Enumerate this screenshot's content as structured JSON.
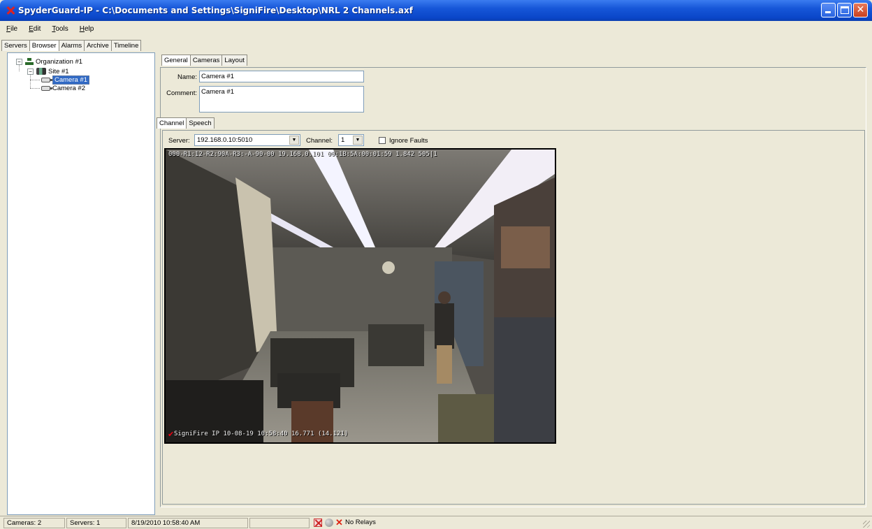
{
  "window": {
    "title": "SpyderGuard-IP - C:\\Documents and Settings\\SigniFire\\Desktop\\NRL 2 Channels.axf"
  },
  "menu": [
    {
      "label": "File",
      "underline": "F",
      "rest": "ile"
    },
    {
      "label": "Edit",
      "underline": "E",
      "rest": "dit"
    },
    {
      "label": "Tools",
      "underline": "T",
      "rest": "ools"
    },
    {
      "label": "Help",
      "underline": "H",
      "rest": "elp"
    }
  ],
  "left_tabs": [
    "Servers",
    "Browser",
    "Alarms",
    "Archive",
    "Timeline"
  ],
  "left_active_tab": "Browser",
  "tree": {
    "organization": "Organization #1",
    "site": "Site #1",
    "cameras": [
      "Camera #1",
      "Camera #2"
    ],
    "selected": "Camera #1"
  },
  "right_tabs": [
    "General",
    "Cameras",
    "Layout"
  ],
  "right_active_tab": "General",
  "general": {
    "name_label": "Name:",
    "name_value": "Camera #1",
    "comment_label": "Comment:",
    "comment_value": "Camera #1"
  },
  "channel_tabs": [
    "Channel",
    "Speech"
  ],
  "channel_active_tab": "Channel",
  "channel": {
    "server_label": "Server:",
    "server_value": "192.168.0.10:5010",
    "channel_label": "Channel:",
    "channel_value": "1",
    "ignore_faults_label": "Ignore Faults",
    "ignore_faults_checked": false
  },
  "camera_view": {
    "osd_top": "000-R1:12-R2:90A-R3:-A-90-00  19.168.0.101  00:1B:5A:00:01:59  1.842  505|1",
    "osd_bottom": "SigniFire IP 10-08-19 10:58:40 16.771 (14.121)"
  },
  "status": {
    "cameras": "Cameras: 2",
    "servers": "Servers: 1",
    "datetime": "8/19/2010 10:58:40 AM",
    "relays": "No Relays"
  },
  "colors": {
    "titlebar": "#0a46c8",
    "window_bg": "#ece9d8",
    "selection": "#316ac5"
  }
}
